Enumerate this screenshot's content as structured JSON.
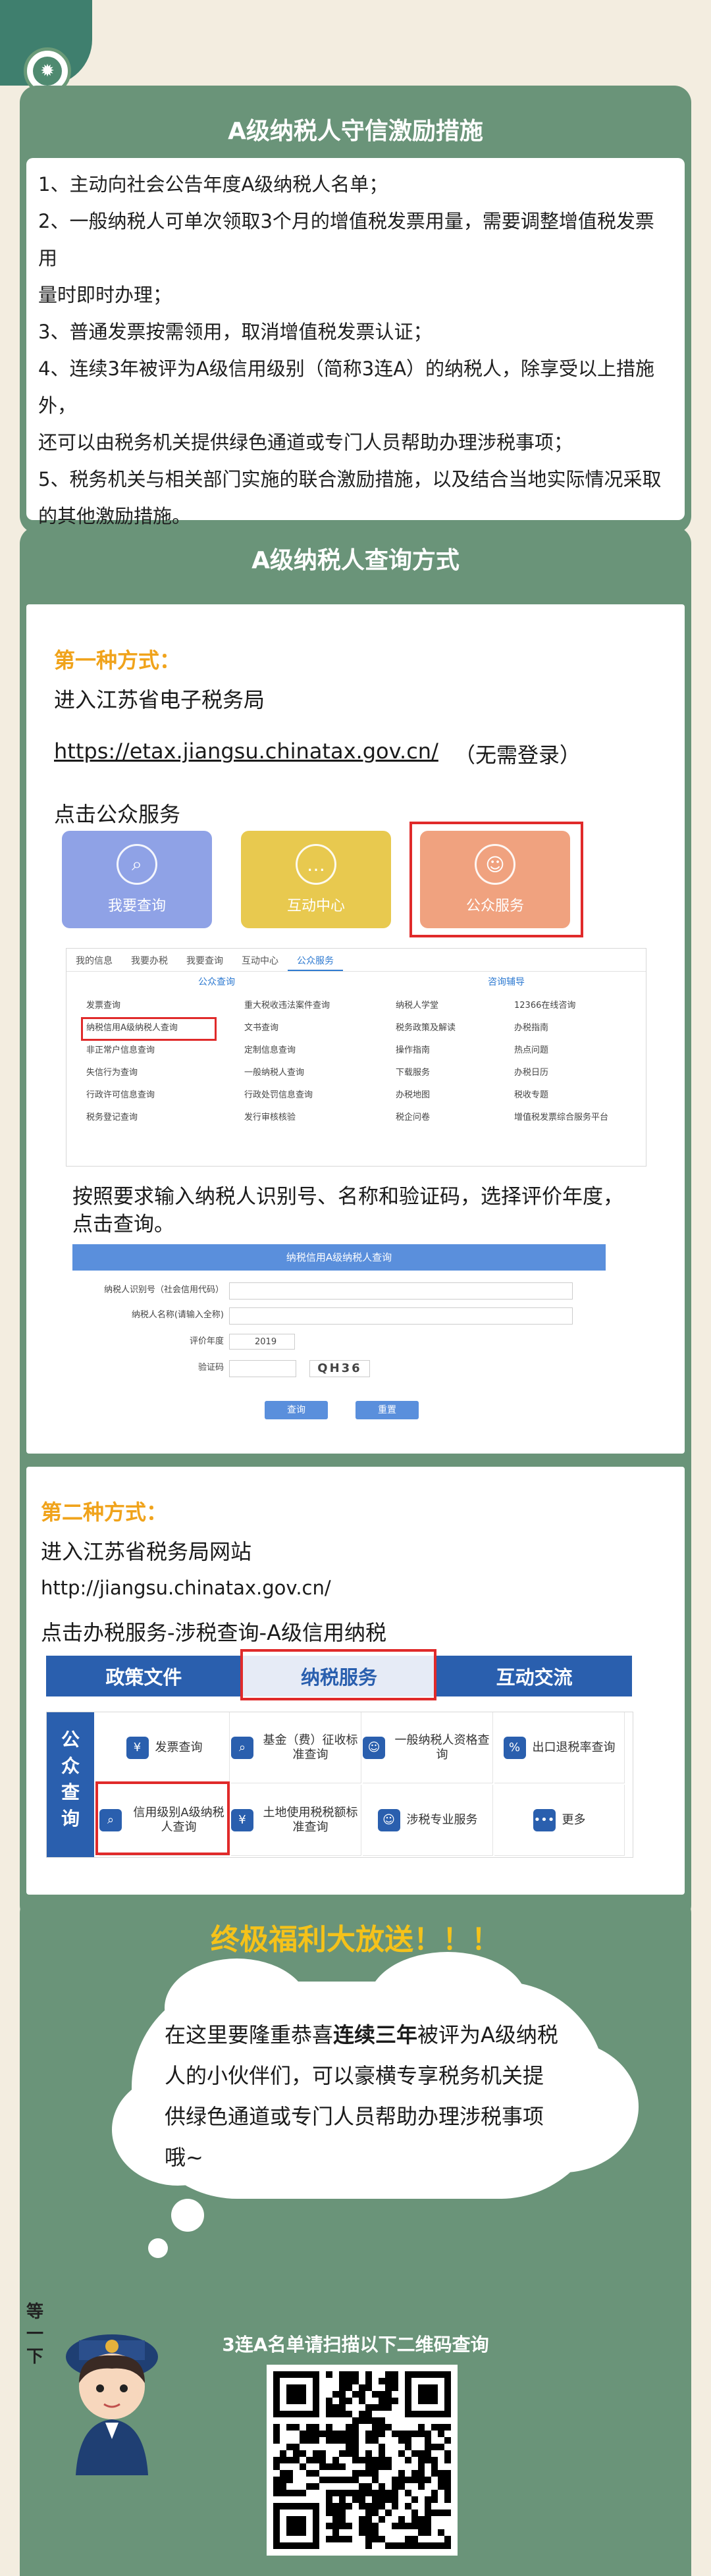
{
  "section1": {
    "title": "A级纳税人守信激励措施",
    "rules": [
      "1、主动向社会公告年度A级纳税人名单；",
      "2、一般纳税人可单次领取3个月的增值税发票用量，需要调整增值税发票用",
      "量时即时办理；",
      "3、普通发票按需领用，取消增值税发票认证；",
      "4、连续3年被评为A级信用级别（简称3连A）的纳税人，除享受以上措施外，",
      "还可以由税务机关提供绿色通道或专门人员帮助办理涉税事项；",
      "5、税务机关与相关部门实施的联合激励措施，以及结合当地实际情况采取",
      "的其他激励措施。"
    ]
  },
  "section2": {
    "title": "A级纳税人查询方式",
    "way1": {
      "heading": "第一种方式：",
      "enter": "进入江苏省电子税务局",
      "url": "https://etax.jiangsu.chinatax.gov.cn/",
      "url_note": "（无需登录）",
      "click": "点击公众服务",
      "cards": [
        "我要查询",
        "互动中心",
        "公众服务"
      ],
      "menu_tabs": [
        "我的信息",
        "我要办税",
        "我要查询",
        "互动中心",
        "公众服务"
      ],
      "menu_head_left": "公众查询",
      "menu_head_right": "咨询辅导",
      "menu_col1": [
        "发票查询",
        "纳税信用A级纳税人查询",
        "非正常户信息查询",
        "失信行为查询",
        "行政许可信息查询",
        "税务登记查询"
      ],
      "menu_col2": [
        "重大税收违法案件查询",
        "文书查询",
        "定制信息查询",
        "一般纳税人查询",
        "行政处罚信息查询",
        "发行审核核验"
      ],
      "menu_col3": [
        "纳税人学堂",
        "税务政策及解读",
        "操作指南",
        "下载服务",
        "办税地图",
        "税企问卷"
      ],
      "menu_col4": [
        "12366在线咨询",
        "办税指南",
        "热点问题",
        "办税日历",
        "税收专题",
        "增值税发票综合服务平台"
      ],
      "instruction": "按照要求输入纳税人识别号、名称和验证码，选择评价年度，",
      "instruction2": "点击查询。",
      "form_title": "纳税信用A级纳税人查询",
      "form_id_label": "纳税人识别号（社会信用代码）",
      "form_name_label": "纳税人名称(请输入全称)",
      "form_year_label": "评价年度",
      "form_year_value": "2019",
      "form_code_label": "验证码",
      "form_captcha": "QH36",
      "form_query_btn": "查询",
      "form_reset_btn": "重置"
    },
    "way2": {
      "heading": "第二种方式：",
      "enter": "进入江苏省税务局网站",
      "url": "http://jiangsu.chinatax.gov.cn/",
      "click": "点击办税服务-涉税查询-A级信用纳税",
      "nav": [
        "政策文件",
        "纳税服务",
        "互动交流"
      ],
      "side_label": [
        "公",
        "众",
        "查",
        "询"
      ],
      "cells": [
        "发票查询",
        "基金（费）征收标准查询",
        "一般纳税人资格查询",
        "出口退税率查询",
        "信用级别A级纳税人查询",
        "土地使用税税额标准查询",
        "涉税专业服务",
        "更多"
      ]
    }
  },
  "section3": {
    "title": "终极福利大放送！！！",
    "cloud_pre": "在这里要隆重恭喜",
    "cloud_bold": "连续三年",
    "cloud_post": "被评为A级纳税人的小伙伴们，可以豪横专享税务机关提供绿色通道或专门人员帮助办理涉税事项哦~",
    "mascot_text": "等一下",
    "scan": "3连A名单请扫描以下二维码查询"
  }
}
